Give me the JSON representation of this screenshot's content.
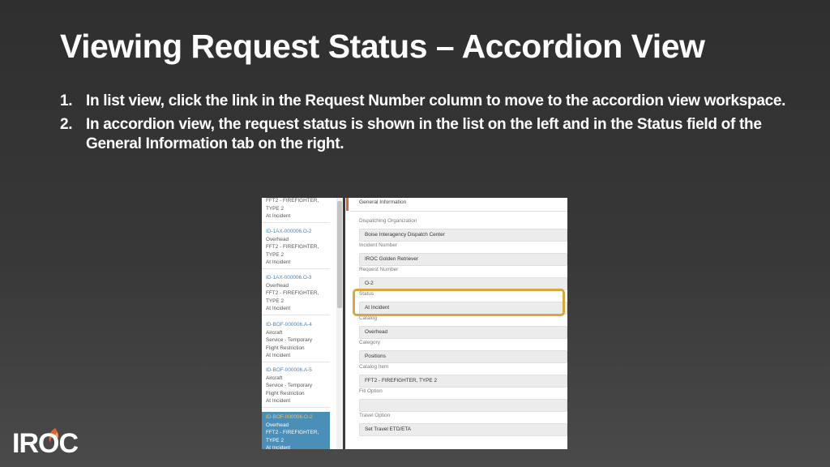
{
  "slide": {
    "title": "Viewing Request Status – Accordion View",
    "steps": [
      {
        "num": "1.",
        "text": "In list view, click the link in the Request Number column to move to the accordion view workspace."
      },
      {
        "num": "2.",
        "text": "In accordion view, the request status is shown in the list on the left and in the Status field of the General Information tab on the right."
      }
    ]
  },
  "list_items": [
    {
      "id": "",
      "lines": [
        "FFT2 - FIREFIGHTER,",
        "TYPE 2",
        "At Incident"
      ],
      "selected": false
    },
    {
      "id": "ID-1AX-000006.O-2",
      "lines": [
        "Overhead",
        "FFT2 - FIREFIGHTER,",
        "TYPE 2",
        "At Incident"
      ],
      "selected": false
    },
    {
      "id": "ID-1AX-000006.O-3",
      "lines": [
        "Overhead",
        "FFT2 - FIREFIGHTER,",
        "TYPE 2",
        "At Incident"
      ],
      "selected": false
    },
    {
      "id": "ID-BOF-000006.A-4",
      "lines": [
        "Aircraft",
        "Service - Temporary",
        "Flight Restriction",
        "At Incident"
      ],
      "selected": false
    },
    {
      "id": "ID-BOF-000006.A-5",
      "lines": [
        "Aircraft",
        "Service - Temporary",
        "Flight Restriction",
        "At Incident"
      ],
      "selected": false
    },
    {
      "id": "ID-BOF-000006.O-2",
      "lines": [
        "Overhead",
        "FFT2 - FIREFIGHTER,",
        "TYPE 2",
        "At Incident"
      ],
      "selected": true
    }
  ],
  "form": {
    "section_title": "General Information",
    "fields": [
      {
        "label": "Dispatching Organization",
        "value": "Boise Interagency Dispatch Center"
      },
      {
        "label": "Incident Number",
        "value": "IROC Golden Retriever"
      },
      {
        "label": "Request Number",
        "value": "O-2"
      },
      {
        "label": "Status",
        "value": "At Incident"
      },
      {
        "label": "Catalog",
        "value": "Overhead"
      },
      {
        "label": "Category",
        "value": "Positions"
      },
      {
        "label": "Catalog Item",
        "value": "FFT2 - FIREFIGHTER, TYPE 2"
      },
      {
        "label": "Fill Option",
        "value": ""
      },
      {
        "label": "Travel Option",
        "value": "Set Travel ETD/ETA"
      }
    ],
    "highlight_color": "#d9a83a"
  },
  "logo": {
    "text": "IROC",
    "flame_colors": [
      "#e0603a",
      "#f08a3c"
    ]
  }
}
